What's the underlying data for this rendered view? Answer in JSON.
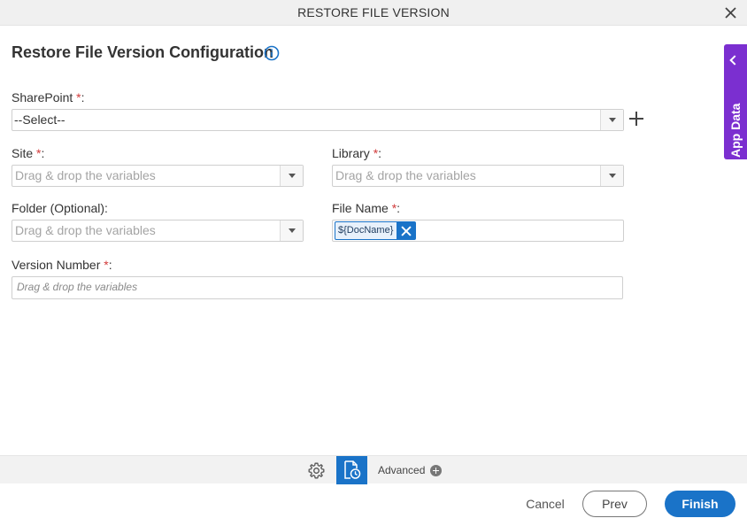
{
  "dialog": {
    "title": "RESTORE FILE VERSION",
    "heading": "Restore File Version Configuration"
  },
  "form": {
    "sharepoint": {
      "label": "SharePoint",
      "required_mark": "*",
      "suffix": ":",
      "value": "--Select--"
    },
    "site": {
      "label": "Site",
      "required_mark": "*",
      "suffix": ":",
      "placeholder": "Drag & drop the variables"
    },
    "library": {
      "label": "Library",
      "required_mark": "*",
      "suffix": ":",
      "placeholder": "Drag & drop the variables"
    },
    "folder": {
      "label": "Folder (Optional):",
      "placeholder": "Drag & drop the variables"
    },
    "file_name": {
      "label": "File Name",
      "required_mark": "*",
      "suffix": ":",
      "chip": "${DocName}"
    },
    "version_number": {
      "label": "Version Number",
      "required_mark": "*",
      "suffix": ":",
      "placeholder": "Drag & drop the variables"
    }
  },
  "side_panel": {
    "label": "App Data"
  },
  "toolbar": {
    "advanced_label": "Advanced"
  },
  "footer": {
    "cancel": "Cancel",
    "prev": "Prev",
    "finish": "Finish"
  },
  "colors": {
    "primary": "#1a73c8",
    "app_data": "#7b2fd0",
    "required": "#d23b3b"
  }
}
